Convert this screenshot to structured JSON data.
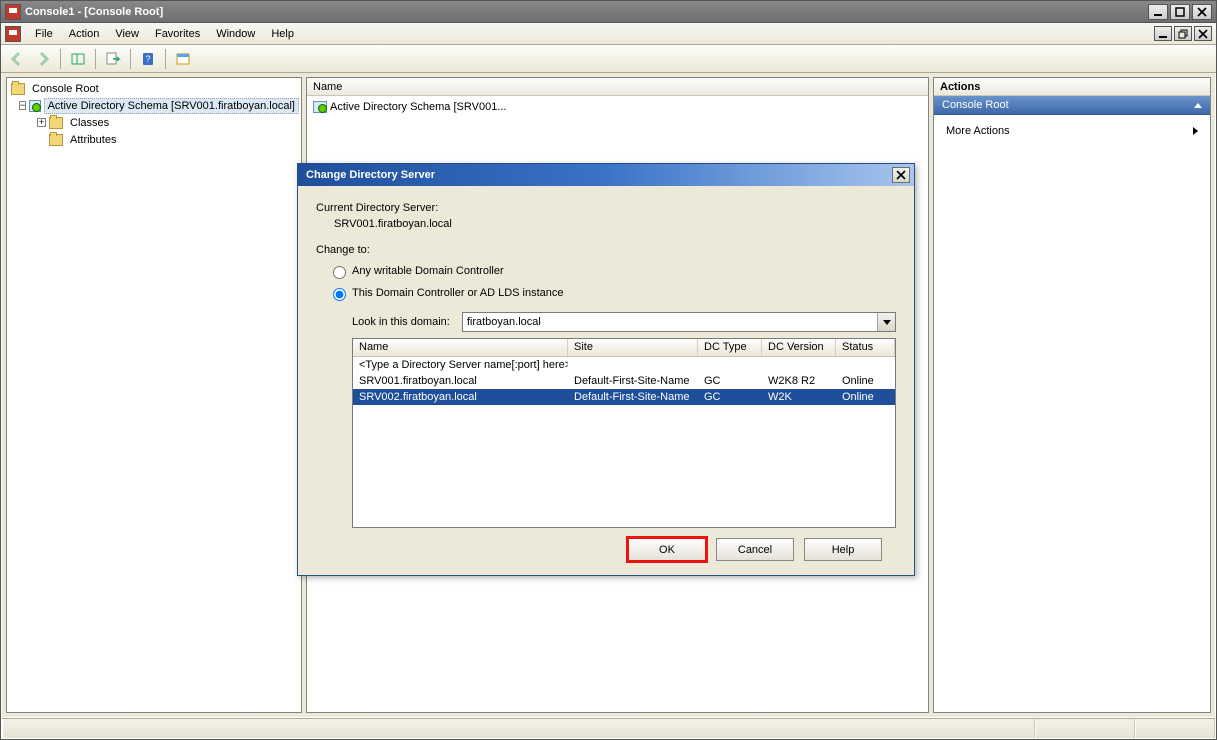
{
  "window": {
    "title": "Console1 - [Console Root]"
  },
  "menu": {
    "file": "File",
    "action": "Action",
    "view": "View",
    "favorites": "Favorites",
    "window": "Window",
    "help": "Help"
  },
  "tree": {
    "root": "Console Root",
    "schema": "Active Directory Schema [SRV001.firatboyan.local]",
    "classes": "Classes",
    "attributes": "Attributes"
  },
  "content": {
    "header_name": "Name",
    "item0": "Active Directory Schema [SRV001..."
  },
  "actions": {
    "header": "Actions",
    "section_title": "Console Root",
    "more_actions": "More Actions"
  },
  "dialog": {
    "title": "Change Directory Server",
    "current_label": "Current Directory Server:",
    "current_value": "SRV001.firatboyan.local",
    "change_to_label": "Change to:",
    "radio_any": "Any writable Domain Controller",
    "radio_this": "This Domain Controller or AD LDS instance",
    "lookin_label": "Look in this domain:",
    "domain_value": "firatboyan.local",
    "cols": {
      "name": "Name",
      "site": "Site",
      "dctype": "DC Type",
      "dcver": "DC Version",
      "status": "Status"
    },
    "rows": [
      {
        "name": "<Type a Directory Server name[:port] here>",
        "site": "",
        "dctype": "",
        "dcver": "",
        "status": ""
      },
      {
        "name": "SRV001.firatboyan.local",
        "site": "Default-First-Site-Name",
        "dctype": "GC",
        "dcver": "W2K8 R2",
        "status": "Online"
      },
      {
        "name": "SRV002.firatboyan.local",
        "site": "Default-First-Site-Name",
        "dctype": "GC",
        "dcver": "W2K",
        "status": "Online"
      }
    ],
    "ok": "OK",
    "cancel": "Cancel",
    "help": "Help"
  }
}
